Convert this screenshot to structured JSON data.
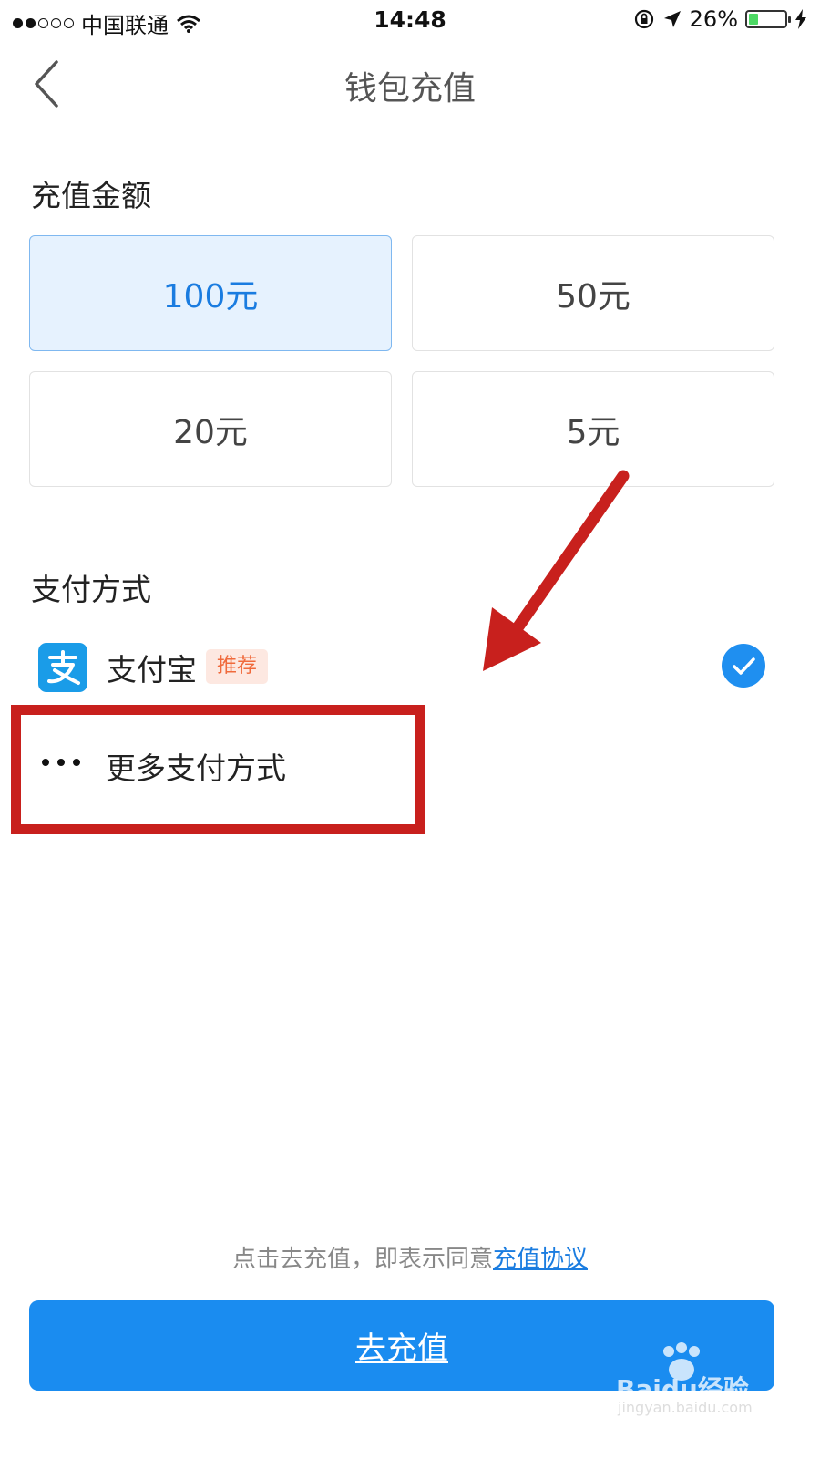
{
  "status_bar": {
    "carrier": "中国联通",
    "time": "14:48",
    "battery_percent": "26%",
    "battery_level": 0.26,
    "signal_bars_on": 2,
    "signal_bars_total": 5
  },
  "nav": {
    "title": "钱包充值",
    "back_icon": "chevron-left-icon"
  },
  "amount_section": {
    "title": "充值金额",
    "options": [
      {
        "label": "100元",
        "selected": true
      },
      {
        "label": "50元",
        "selected": false
      },
      {
        "label": "20元",
        "selected": false
      },
      {
        "label": "5元",
        "selected": false
      }
    ]
  },
  "payment_section": {
    "title": "支付方式",
    "methods": [
      {
        "label": "支付宝",
        "badge": "推荐",
        "selected": true,
        "icon": "alipay-icon"
      }
    ],
    "more_label": "更多支付方式",
    "more_icon": "ellipsis-icon"
  },
  "footer": {
    "agreement_text": "点击去充值，即表示同意",
    "agreement_link": "充值协议",
    "submit_label": "去充值"
  },
  "watermark": {
    "brand": "Baidu经验",
    "url": "jingyan.baidu.com"
  },
  "colors": {
    "accent": "#1a8cf0",
    "selected_bg": "#e6f2fe",
    "badge_bg": "#fde8e1",
    "badge_text": "#f06a3c",
    "annotation_red": "#c8201d"
  }
}
